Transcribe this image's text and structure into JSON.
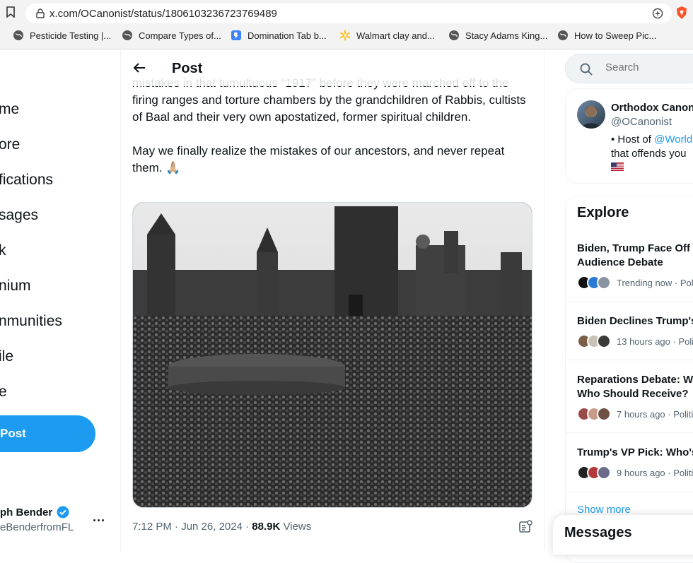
{
  "browser": {
    "url": "x.com/OCanonist/status/1806103236723769489",
    "bookmarks": [
      {
        "label": "Pesticide Testing |...",
        "icon": "globe-icon"
      },
      {
        "label": "Compare Types of...",
        "icon": "globe-icon"
      },
      {
        "label": "Domination Tab b...",
        "icon": "app-icon"
      },
      {
        "label": "Walmart clay and...",
        "icon": "walmart-spark-icon"
      },
      {
        "label": "Stacy Adams King...",
        "icon": "globe-icon"
      },
      {
        "label": "How to Sweep Pic...",
        "icon": "globe-icon"
      }
    ]
  },
  "nav": {
    "items": [
      "me",
      "ore",
      "fications",
      "sages",
      "k",
      "nium",
      "nmunities",
      "ile",
      "e"
    ],
    "post_button": "Post",
    "account_name": "ph Bender",
    "account_handle": "eBenderfromFL",
    "more": "..."
  },
  "post": {
    "header_title": "Post",
    "paragraph1": "mistakes in that tumultuous “1917” before they were marched off to the firing ranges and torture chambers by the grandchildren of Rabbis, cultists of Baal and their very own apostatized, former spiritual children.",
    "paragraph2": "May we finally realize the mistakes of our ancestors, and never repeat them. 🙏🏼",
    "time": "7:12 PM · Jun 26, 2024 · ",
    "views_count": "88.9K",
    "views_label": " Views"
  },
  "sidebar": {
    "search_placeholder": "Search",
    "profile": {
      "name": "Orthodox Canon",
      "handle": "@OCanonist",
      "bio_prefix": "• Host of ",
      "bio_link": "@World",
      "bio_line2": "that offends you"
    },
    "explore_title": "Explore",
    "trends": [
      {
        "line1": "Biden, Trump Face Off",
        "line2": "Audience Debate",
        "meta": "Trending now · Poli"
      },
      {
        "line1": "Biden Declines Trump's",
        "line2": "",
        "meta": "13 hours ago · Politi"
      },
      {
        "line1": "Reparations Debate: W",
        "line2": "Who Should Receive?",
        "meta": "7 hours ago · Politi"
      },
      {
        "line1": "Trump's VP Pick: Who's",
        "line2": "",
        "meta": "9 hours ago · Politi"
      }
    ],
    "show_more": "Show more",
    "messages": "Messages"
  },
  "colors": {
    "accent": "#1d9bf0",
    "text": "#0f1419",
    "muted": "#536471"
  }
}
